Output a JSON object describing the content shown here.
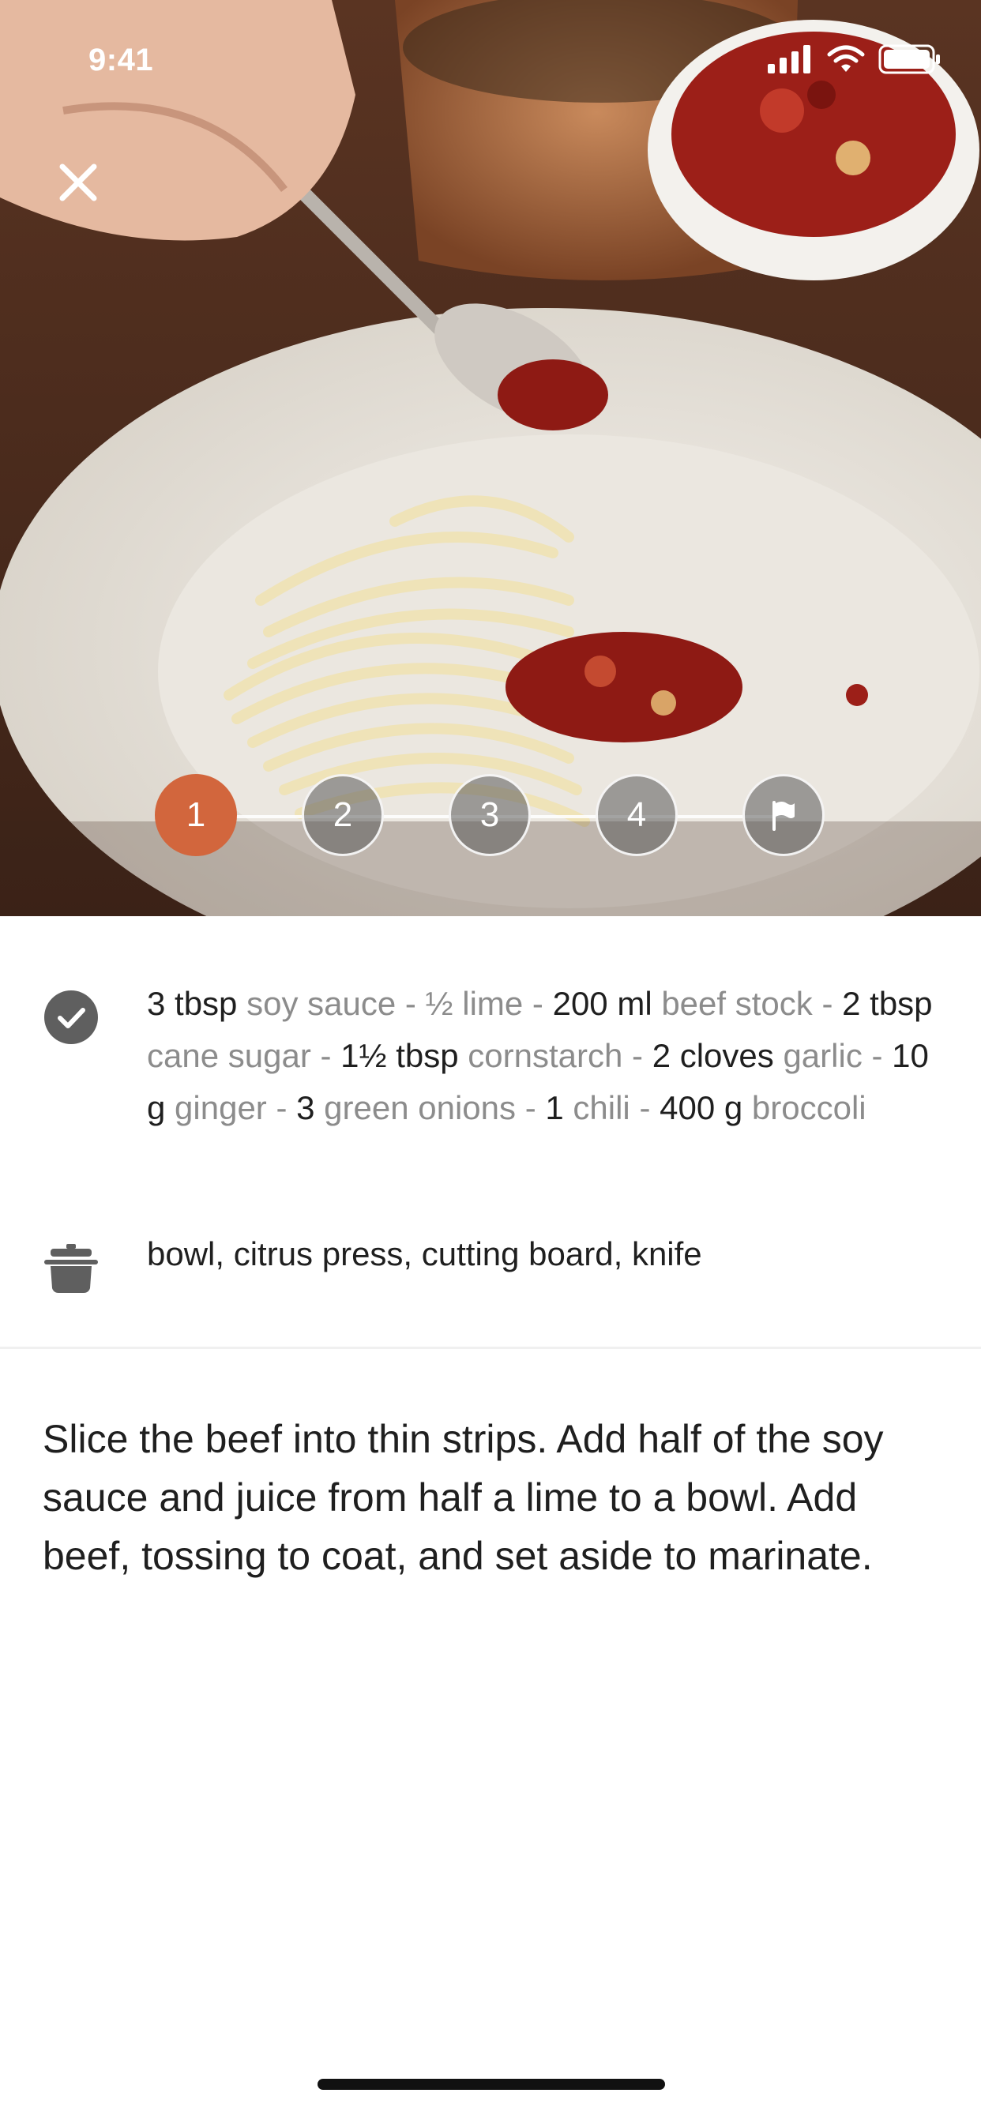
{
  "status_bar": {
    "time": "9:41"
  },
  "stepper": {
    "steps": [
      "1",
      "2",
      "3",
      "4"
    ],
    "active_step": 1,
    "finish_icon": "flag-icon"
  },
  "ingredients": {
    "icon": "check-circle-icon",
    "items": [
      {
        "qty": "3 tbsp",
        "name": "soy sauce"
      },
      {
        "qty": "",
        "name": "½ lime"
      },
      {
        "qty": "200 ml",
        "name": "beef stock"
      },
      {
        "qty": "2 tbsp",
        "name": "cane sugar"
      },
      {
        "qty": "1½ tbsp",
        "name": "cornstarch"
      },
      {
        "qty": "2 cloves",
        "name": "garlic"
      },
      {
        "qty": "10 g",
        "name": "ginger"
      },
      {
        "qty": "3",
        "name": "green onions"
      },
      {
        "qty": "1",
        "name": "chili"
      },
      {
        "qty": "400 g",
        "name": "broccoli"
      }
    ]
  },
  "tools": {
    "icon": "cooking-pot-icon",
    "text": "bowl, citrus press, cutting board, knife"
  },
  "instructions": {
    "text": "Slice the beef into thin strips. Add half of the soy sauce and juice from half a lime to a bowl. Add beef, tossing to coat, and set aside to marinate."
  },
  "colors": {
    "accent": "#d2663d",
    "ingredient_name": "#8c8c8c",
    "text": "#1f1f1f"
  }
}
